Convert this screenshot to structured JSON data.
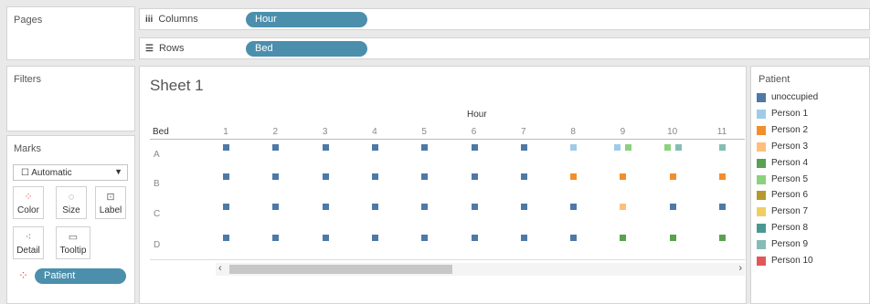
{
  "pages": {
    "title": "Pages"
  },
  "filters": {
    "title": "Filters"
  },
  "columns": {
    "label": "Columns",
    "symbol": "iii",
    "pill": "Hour"
  },
  "rows": {
    "label": "Rows",
    "symbol": "☰",
    "pill": "Bed"
  },
  "marks": {
    "title": "Marks",
    "dropdown": "Automatic",
    "buttons": {
      "color": "Color",
      "size": "Size",
      "label": "Label",
      "detail": "Detail",
      "tooltip": "Tooltip"
    },
    "field": "Patient"
  },
  "sheet": {
    "title": "Sheet 1",
    "col_header": "Hour",
    "row_header": "Bed"
  },
  "chart_data": {
    "type": "scatter",
    "x_field": "Hour",
    "y_field": "Bed",
    "hours": [
      "1",
      "2",
      "3",
      "4",
      "5",
      "6",
      "7",
      "8",
      "9",
      "10",
      "11"
    ],
    "beds": [
      "A",
      "B",
      "C",
      "D"
    ],
    "points": [
      {
        "bed": "A",
        "hour": 1,
        "patient": "unoccupied"
      },
      {
        "bed": "A",
        "hour": 2,
        "patient": "unoccupied"
      },
      {
        "bed": "A",
        "hour": 3,
        "patient": "unoccupied"
      },
      {
        "bed": "A",
        "hour": 4,
        "patient": "unoccupied"
      },
      {
        "bed": "A",
        "hour": 5,
        "patient": "unoccupied"
      },
      {
        "bed": "A",
        "hour": 6,
        "patient": "unoccupied"
      },
      {
        "bed": "A",
        "hour": 7,
        "patient": "unoccupied"
      },
      {
        "bed": "A",
        "hour": 8,
        "patient": "Person 1"
      },
      {
        "bed": "A",
        "hour": 9,
        "patient": "Person 1",
        "offset": -1
      },
      {
        "bed": "A",
        "hour": 9,
        "patient": "Person 5",
        "offset": 1
      },
      {
        "bed": "A",
        "hour": 10,
        "patient": "Person 5",
        "offset": -1
      },
      {
        "bed": "A",
        "hour": 10,
        "patient": "Person 9",
        "offset": 1
      },
      {
        "bed": "A",
        "hour": 11,
        "patient": "Person 9"
      },
      {
        "bed": "B",
        "hour": 1,
        "patient": "unoccupied"
      },
      {
        "bed": "B",
        "hour": 2,
        "patient": "unoccupied"
      },
      {
        "bed": "B",
        "hour": 3,
        "patient": "unoccupied"
      },
      {
        "bed": "B",
        "hour": 4,
        "patient": "unoccupied"
      },
      {
        "bed": "B",
        "hour": 5,
        "patient": "unoccupied"
      },
      {
        "bed": "B",
        "hour": 6,
        "patient": "unoccupied"
      },
      {
        "bed": "B",
        "hour": 7,
        "patient": "unoccupied"
      },
      {
        "bed": "B",
        "hour": 8,
        "patient": "Person 2"
      },
      {
        "bed": "B",
        "hour": 9,
        "patient": "Person 2"
      },
      {
        "bed": "B",
        "hour": 10,
        "patient": "Person 2"
      },
      {
        "bed": "B",
        "hour": 11,
        "patient": "Person 2"
      },
      {
        "bed": "C",
        "hour": 1,
        "patient": "unoccupied"
      },
      {
        "bed": "C",
        "hour": 2,
        "patient": "unoccupied"
      },
      {
        "bed": "C",
        "hour": 3,
        "patient": "unoccupied"
      },
      {
        "bed": "C",
        "hour": 4,
        "patient": "unoccupied"
      },
      {
        "bed": "C",
        "hour": 5,
        "patient": "unoccupied"
      },
      {
        "bed": "C",
        "hour": 6,
        "patient": "unoccupied"
      },
      {
        "bed": "C",
        "hour": 7,
        "patient": "unoccupied"
      },
      {
        "bed": "C",
        "hour": 8,
        "patient": "unoccupied"
      },
      {
        "bed": "C",
        "hour": 9,
        "patient": "Person 3"
      },
      {
        "bed": "C",
        "hour": 10,
        "patient": "unoccupied"
      },
      {
        "bed": "C",
        "hour": 11,
        "patient": "unoccupied"
      },
      {
        "bed": "D",
        "hour": 1,
        "patient": "unoccupied"
      },
      {
        "bed": "D",
        "hour": 2,
        "patient": "unoccupied"
      },
      {
        "bed": "D",
        "hour": 3,
        "patient": "unoccupied"
      },
      {
        "bed": "D",
        "hour": 4,
        "patient": "unoccupied"
      },
      {
        "bed": "D",
        "hour": 5,
        "patient": "unoccupied"
      },
      {
        "bed": "D",
        "hour": 6,
        "patient": "unoccupied"
      },
      {
        "bed": "D",
        "hour": 7,
        "patient": "unoccupied"
      },
      {
        "bed": "D",
        "hour": 8,
        "patient": "unoccupied"
      },
      {
        "bed": "D",
        "hour": 9,
        "patient": "Person 4"
      },
      {
        "bed": "D",
        "hour": 10,
        "patient": "Person 4"
      },
      {
        "bed": "D",
        "hour": 11,
        "patient": "Person 4"
      }
    ]
  },
  "legend": {
    "title": "Patient",
    "items": [
      {
        "label": "unoccupied",
        "color": "#4e79a7"
      },
      {
        "label": "Person 1",
        "color": "#a0cbe8"
      },
      {
        "label": "Person 2",
        "color": "#f28e2b"
      },
      {
        "label": "Person 3",
        "color": "#ffbe7d"
      },
      {
        "label": "Person 4",
        "color": "#59a14f"
      },
      {
        "label": "Person 5",
        "color": "#8cd17d"
      },
      {
        "label": "Person 6",
        "color": "#b6992d"
      },
      {
        "label": "Person 7",
        "color": "#f1ce63"
      },
      {
        "label": "Person 8",
        "color": "#499894"
      },
      {
        "label": "Person 9",
        "color": "#86bcb6"
      },
      {
        "label": "Person 10",
        "color": "#e15759"
      }
    ]
  }
}
